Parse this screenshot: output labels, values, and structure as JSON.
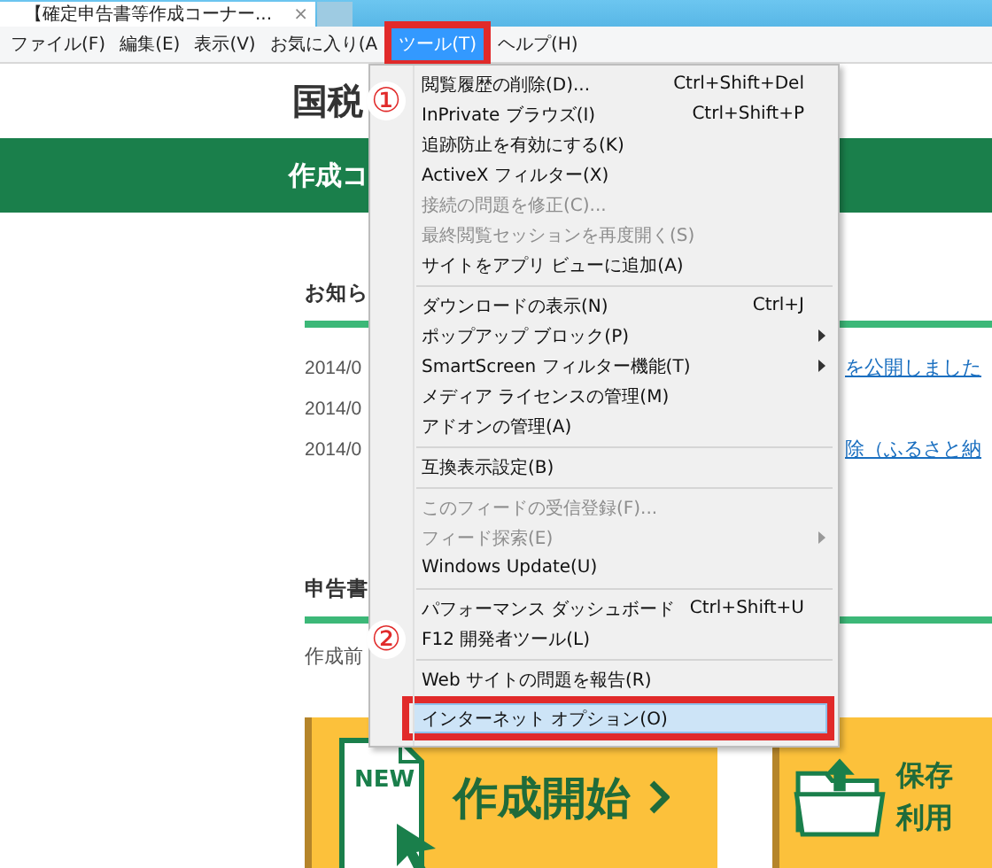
{
  "browser": {
    "tab": {
      "title": "【確定申告書等作成コーナー...",
      "close": "×"
    }
  },
  "menu_bar": {
    "items": [
      {
        "label": "ファイル(F)",
        "selected": false
      },
      {
        "label": "編集(E)",
        "selected": false
      },
      {
        "label": "表示(V)",
        "selected": false
      },
      {
        "label": "お気に入り(A",
        "selected": false
      },
      {
        "label": "ツール(T)",
        "selected": true
      },
      {
        "label": "ヘルプ(H)",
        "selected": false
      }
    ]
  },
  "page": {
    "header": {
      "title": "国税"
    },
    "banner": {
      "title": "作成コ"
    },
    "notices": {
      "heading": "お知ら",
      "rows": [
        {
          "date": "2014/0",
          "link": "を公開しました"
        },
        {
          "date": "2014/0"
        },
        {
          "date": "2014/0",
          "link": "除（ふるさと納"
        }
      ]
    },
    "forms": {
      "heading": "申告書",
      "note": "作成前"
    },
    "cards": [
      {
        "kind": "start",
        "badge": "NEW",
        "lines": [
          "作成開始"
        ]
      },
      {
        "kind": "resume",
        "lines": [
          "保存",
          "利用"
        ]
      }
    ]
  },
  "tools_menu": {
    "items": [
      {
        "kind": "item",
        "label": "閲覧履歴の削除(D)...",
        "shortcut": "Ctrl+Shift+Del",
        "disabled": false,
        "submenu": false,
        "selected": false
      },
      {
        "kind": "item",
        "label": "InPrivate ブラウズ(I)",
        "shortcut": "Ctrl+Shift+P",
        "disabled": false,
        "submenu": false,
        "selected": false
      },
      {
        "kind": "item",
        "label": "追跡防止を有効にする(K)",
        "disabled": false,
        "submenu": false,
        "selected": false
      },
      {
        "kind": "item",
        "label": "ActiveX フィルター(X)",
        "disabled": false,
        "submenu": false,
        "selected": false
      },
      {
        "kind": "item",
        "label": "接続の問題を修正(C)...",
        "disabled": true,
        "submenu": false,
        "selected": false
      },
      {
        "kind": "item",
        "label": "最終閲覧セッションを再度開く(S)",
        "disabled": true,
        "submenu": false,
        "selected": false
      },
      {
        "kind": "item",
        "label": "サイトをアプリ ビューに追加(A)",
        "disabled": false,
        "submenu": false,
        "selected": false
      },
      {
        "kind": "separator"
      },
      {
        "kind": "item",
        "label": "ダウンロードの表示(N)",
        "shortcut": "Ctrl+J",
        "disabled": false,
        "submenu": false,
        "selected": false
      },
      {
        "kind": "item",
        "label": "ポップアップ ブロック(P)",
        "disabled": false,
        "submenu": true,
        "selected": false
      },
      {
        "kind": "item",
        "label": "SmartScreen フィルター機能(T)",
        "disabled": false,
        "submenu": true,
        "selected": false
      },
      {
        "kind": "item",
        "label": "メディア ライセンスの管理(M)",
        "disabled": false,
        "submenu": false,
        "selected": false
      },
      {
        "kind": "item",
        "label": "アドオンの管理(A)",
        "disabled": false,
        "submenu": false,
        "selected": false
      },
      {
        "kind": "separator"
      },
      {
        "kind": "item",
        "label": "互換表示設定(B)",
        "disabled": false,
        "submenu": false,
        "selected": false
      },
      {
        "kind": "separator"
      },
      {
        "kind": "item",
        "label": "このフィードの受信登録(F)...",
        "disabled": true,
        "submenu": false,
        "selected": false
      },
      {
        "kind": "item",
        "label": "フィード探索(E)",
        "disabled": true,
        "submenu": true,
        "selected": false
      },
      {
        "kind": "item",
        "label": "Windows Update(U)",
        "disabled": false,
        "submenu": false,
        "selected": false
      },
      {
        "kind": "separator"
      },
      {
        "kind": "item",
        "label": "パフォーマンス ダッシュボード",
        "shortcut": "Ctrl+Shift+U",
        "disabled": false,
        "submenu": false,
        "selected": false
      },
      {
        "kind": "item",
        "label": "F12 開発者ツール(L)",
        "disabled": false,
        "submenu": false,
        "selected": false
      },
      {
        "kind": "separator"
      },
      {
        "kind": "item",
        "label": "Web サイトの問題を報告(R)",
        "disabled": false,
        "submenu": false,
        "selected": false
      },
      {
        "kind": "item",
        "label": "インターネット オプション(O)",
        "disabled": false,
        "submenu": false,
        "selected": true
      }
    ]
  },
  "annotations": [
    {
      "label": "①"
    },
    {
      "label": "②"
    }
  ]
}
